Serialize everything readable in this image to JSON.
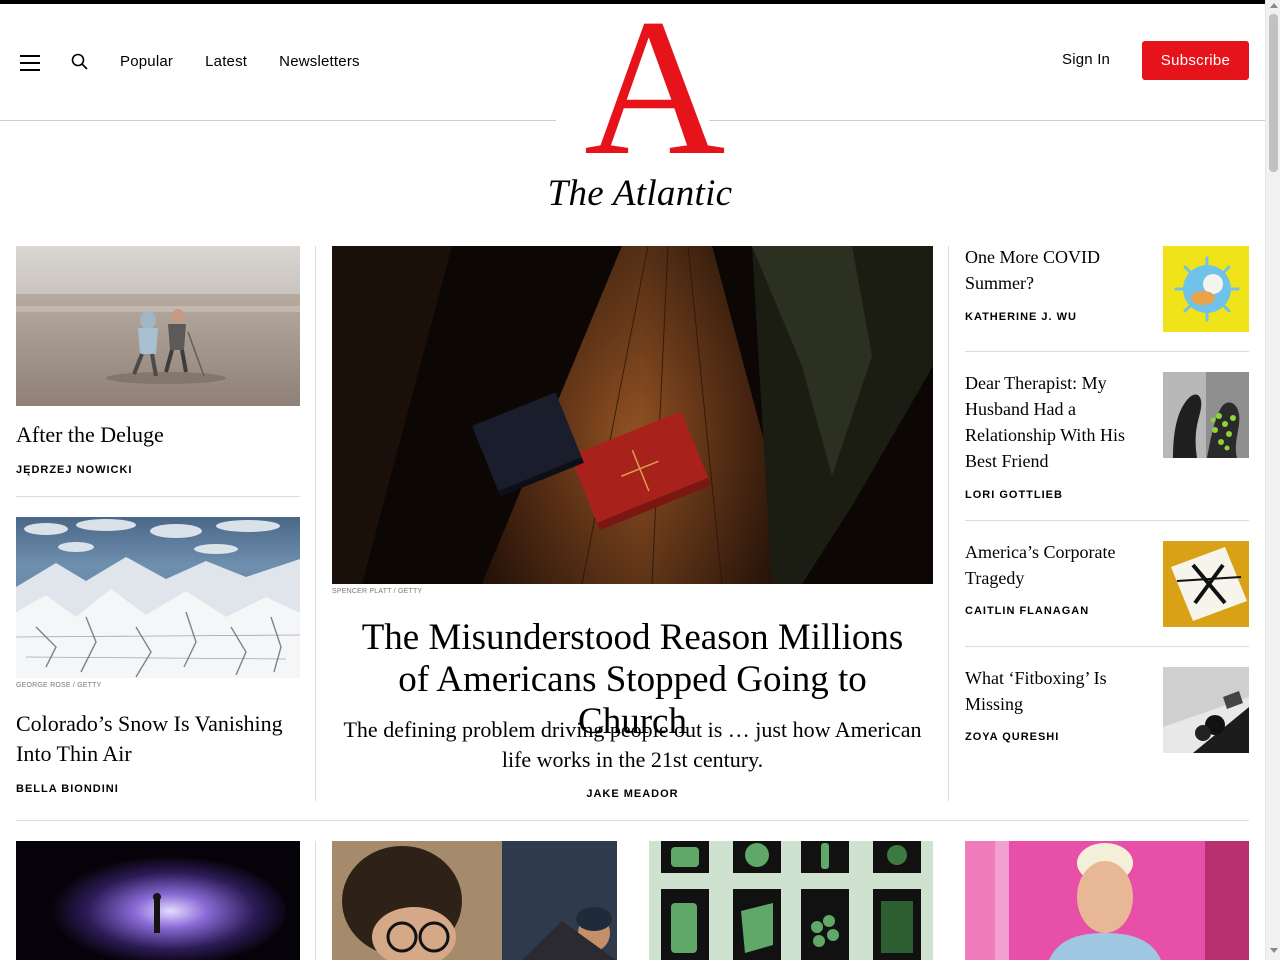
{
  "header": {
    "nav": [
      "Popular",
      "Latest",
      "Newsletters"
    ],
    "sign_in": "Sign In",
    "subscribe": "Subscribe",
    "logo_letter": "A",
    "logo_wordmark": "The Atlantic",
    "icons": {
      "menu": "hamburger-icon",
      "search": "search-icon"
    },
    "brand_color": "#e7131a"
  },
  "left": {
    "story1": {
      "title": "After the Deluge",
      "byline": "JĘDRZEJ NOWICKI"
    },
    "story2": {
      "credit": "GEORGE ROSE / GETTY",
      "title": "Colorado’s Snow Is Vanishing Into Thin Air",
      "byline": "BELLA BIONDINI"
    }
  },
  "main": {
    "credit": "SPENCER PLATT / GETTY",
    "title": "The Misunderstood Reason Millions of Americans Stopped Going to Church",
    "dek": "The defining problem driving people out is … just how American life works in the 21st century.",
    "byline": "JAKE MEADOR"
  },
  "right": [
    {
      "title": "One More COVID Summer?",
      "byline": "KATHERINE J. WU"
    },
    {
      "title": "Dear Therapist: My Husband Had a Relationship With His Best Friend",
      "byline": "LORI GOTTLIEB"
    },
    {
      "title": "America’s Corporate Tragedy",
      "byline": "CAITLIN FLANAGAN"
    },
    {
      "title": "What ‘Fitboxing’ Is Missing",
      "byline": "ZOYA QURESHI"
    }
  ]
}
